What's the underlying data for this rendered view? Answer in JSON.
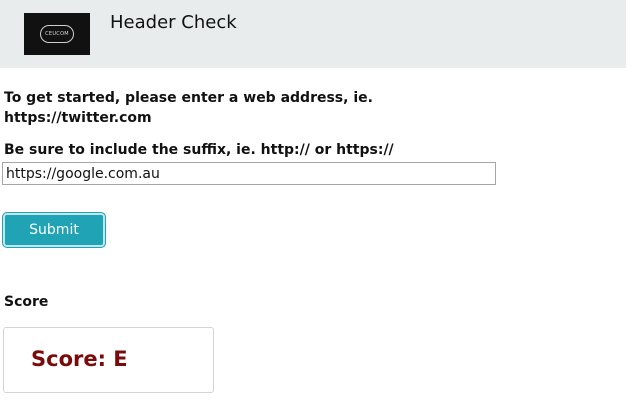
{
  "header": {
    "logo_text": "CEUCOM",
    "title": "Header Check"
  },
  "form": {
    "intro_text": "To get started, please enter a web address, ie. https://twitter.com",
    "suffix_text": "Be sure to include the suffix, ie. http:// or https://",
    "url_value": "https://google.com.au",
    "submit_label": "Submit"
  },
  "score": {
    "heading": "Score",
    "result_text": "Score: E"
  },
  "colors": {
    "header_bg": "#e9eced",
    "button_bg": "#1fa3b5",
    "score_text": "#7a0b0b"
  }
}
